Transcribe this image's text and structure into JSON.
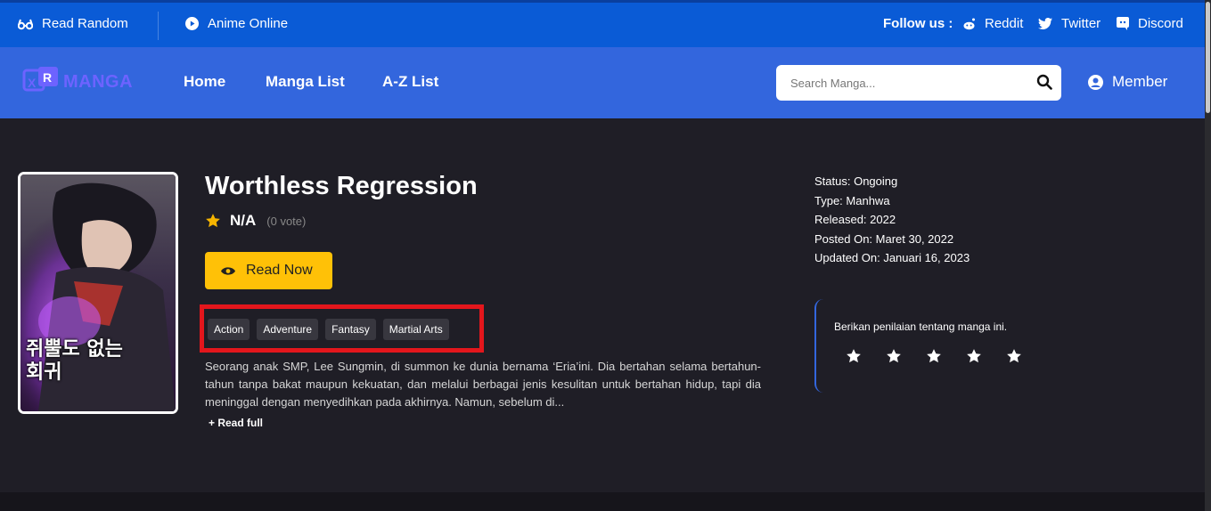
{
  "topbar": {
    "read_random": "Read Random",
    "anime_online": "Anime Online",
    "follow_us": "Follow us :",
    "reddit": "Reddit",
    "twitter": "Twitter",
    "discord": "Discord"
  },
  "navbar": {
    "logo_letters": "XR",
    "logo_text": "MANGA",
    "links": [
      "Home",
      "Manga List",
      "A-Z List"
    ],
    "search_placeholder": "Search Manga...",
    "member": "Member"
  },
  "manga": {
    "title": "Worthless Regression",
    "cover_title_korean": "쥐뿔도 없는 회귀",
    "rating": "N/A",
    "votes": "(0 vote)",
    "read_now": "Read Now",
    "genres": [
      "Action",
      "Adventure",
      "Fantasy",
      "Martial Arts"
    ],
    "synopsis": "Seorang anak SMP, Lee Sungmin, di summon ke dunia bernama ‘Eria’ini. Dia bertahan selama bertahun-tahun tanpa bakat maupun kekuatan, dan melalui berbagai jenis kesulitan untuk bertahan hidup, tapi dia meninggal dengan menyedihkan pada akhirnya. Namun, sebelum di...",
    "read_full": "+ Read full",
    "info": {
      "status": "Status: Ongoing",
      "type": "Type: Manhwa",
      "released": "Released: 2022",
      "posted_on": "Posted On: Maret 30, 2022",
      "updated_on": "Updated On: Januari 16, 2023"
    },
    "rate_prompt": "Berikan penilaian tentang manga ini.",
    "star_count": 5
  },
  "colors": {
    "topbar": "#0a5bd6",
    "navbar": "#3366dd",
    "background": "#1f1e26",
    "accent_button": "#ffc107",
    "highlight_box": "#e3161c",
    "star": "#f5b400"
  }
}
